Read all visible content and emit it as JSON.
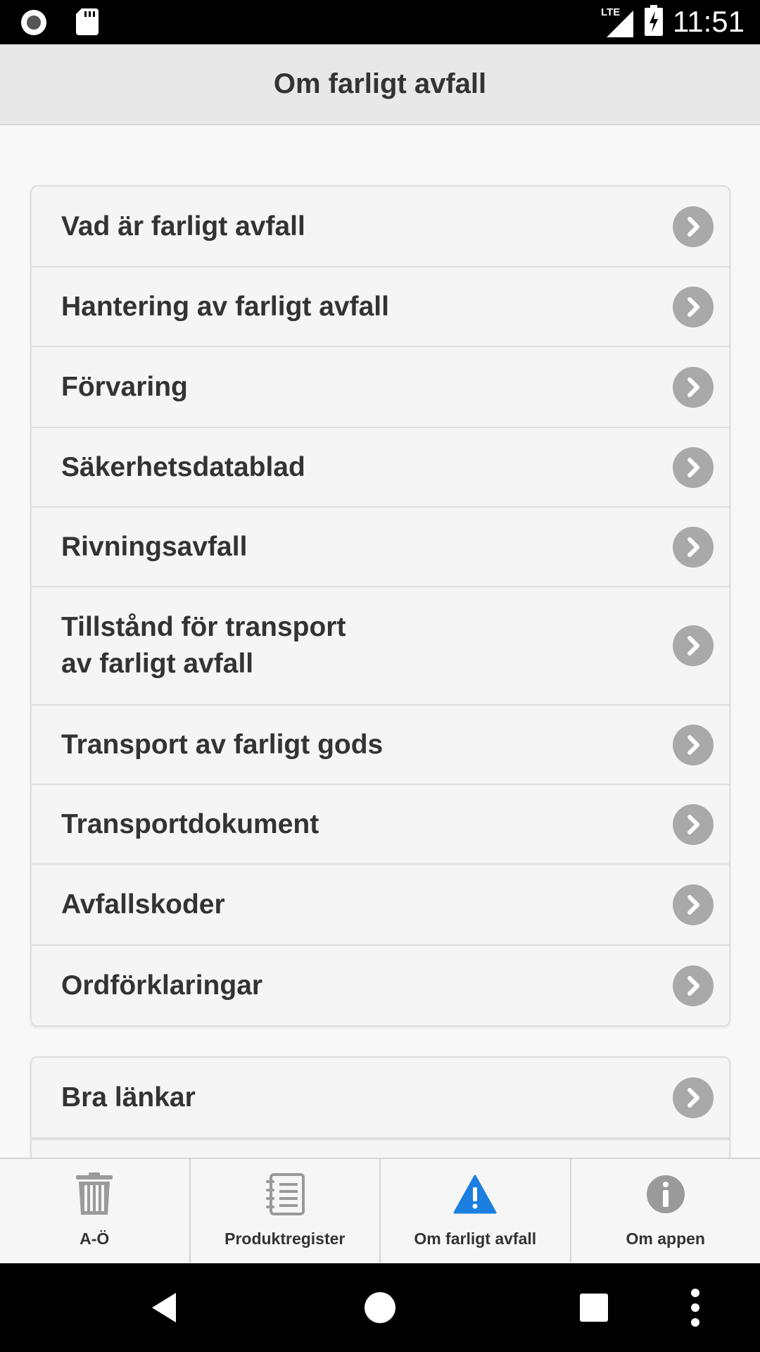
{
  "status_bar": {
    "time": "11:51",
    "network": "LTE",
    "icons": [
      "record-icon",
      "sd-card-icon",
      "signal-icon",
      "battery-charging-icon"
    ]
  },
  "header": {
    "title": "Om farligt avfall"
  },
  "main": {
    "sections": [
      {
        "items": [
          {
            "label": "Vad är farligt avfall"
          },
          {
            "label": "Hantering av farligt avfall"
          },
          {
            "label": "Förvaring"
          },
          {
            "label": "Säkerhetsdatablad"
          },
          {
            "label": "Rivningsavfall"
          },
          {
            "label": "Tillstånd för transport\nav farligt avfall"
          },
          {
            "label": "Transport av farligt gods"
          },
          {
            "label": "Transportdokument"
          },
          {
            "label": "Avfallskoder"
          },
          {
            "label": "Ordförklaringar"
          }
        ]
      },
      {
        "items": [
          {
            "label": "Bra länkar"
          }
        ]
      }
    ]
  },
  "tab_bar": {
    "active_color": "#1a7fe0",
    "tabs": [
      {
        "label": "A-Ö",
        "icon": "trash-can-icon",
        "active": false
      },
      {
        "label": "Produktregister",
        "icon": "notebook-icon",
        "active": false
      },
      {
        "label": "Om farligt avfall",
        "icon": "warning-icon",
        "active": true
      },
      {
        "label": "Om appen",
        "icon": "info-icon",
        "active": false
      }
    ]
  },
  "nav_bar": {
    "buttons": [
      "back-icon",
      "home-icon",
      "recents-icon",
      "more-icon"
    ]
  }
}
